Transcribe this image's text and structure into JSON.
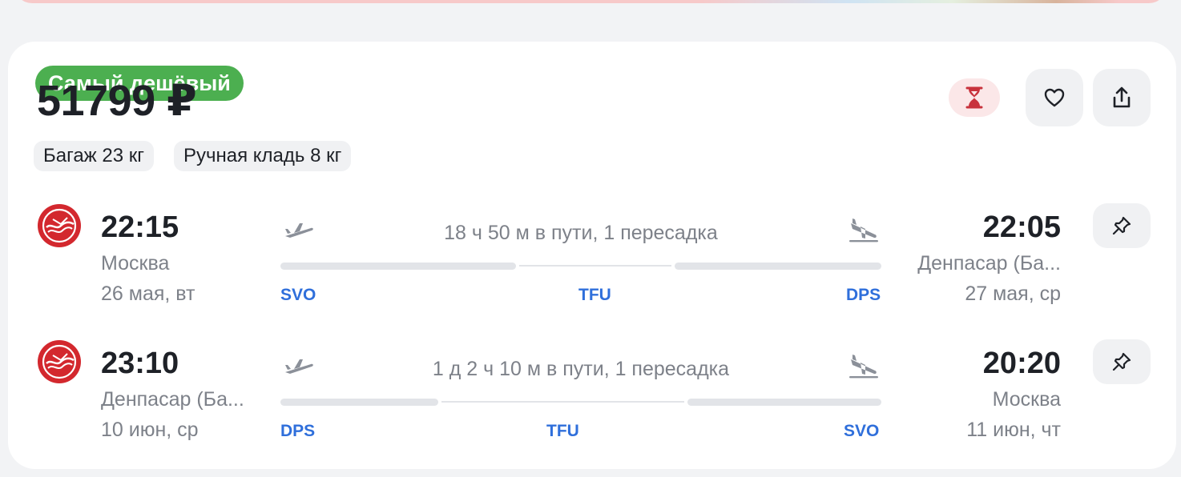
{
  "card": {
    "badge": "Самый дешёвый",
    "price": "51799 ₽",
    "chips": [
      "Багаж 23 кг",
      "Ручная кладь 8 кг"
    ]
  },
  "icons": {
    "timer": "hourglass-icon",
    "favorite": "heart-icon",
    "share": "share-icon",
    "pin": "pin-icon",
    "airline_logo": "airline-logo"
  },
  "colors": {
    "badge_bg": "#4caf50",
    "code_blue": "#2f6fdb",
    "timer_red": "#c8323c",
    "logo_red": "#d3282e"
  },
  "legs": [
    {
      "dep_time": "22:15",
      "dep_city": "Москва",
      "dep_date": "26 мая, вт",
      "duration": "18 ч 50 м в пути, 1 пересадка",
      "codes": [
        "SVO",
        "TFU",
        "DPS"
      ],
      "arr_time": "22:05",
      "arr_city": "Денпасар (Ба...",
      "arr_date": "27 мая, ср"
    },
    {
      "dep_time": "23:10",
      "dep_city": "Денпасар (Ба...",
      "dep_date": "10 июн, ср",
      "duration": "1 д 2 ч 10 м в пути, 1 пересадка",
      "codes": [
        "DPS",
        "TFU",
        "SVO"
      ],
      "arr_time": "20:20",
      "arr_city": "Москва",
      "arr_date": "11 июн, чт"
    }
  ]
}
